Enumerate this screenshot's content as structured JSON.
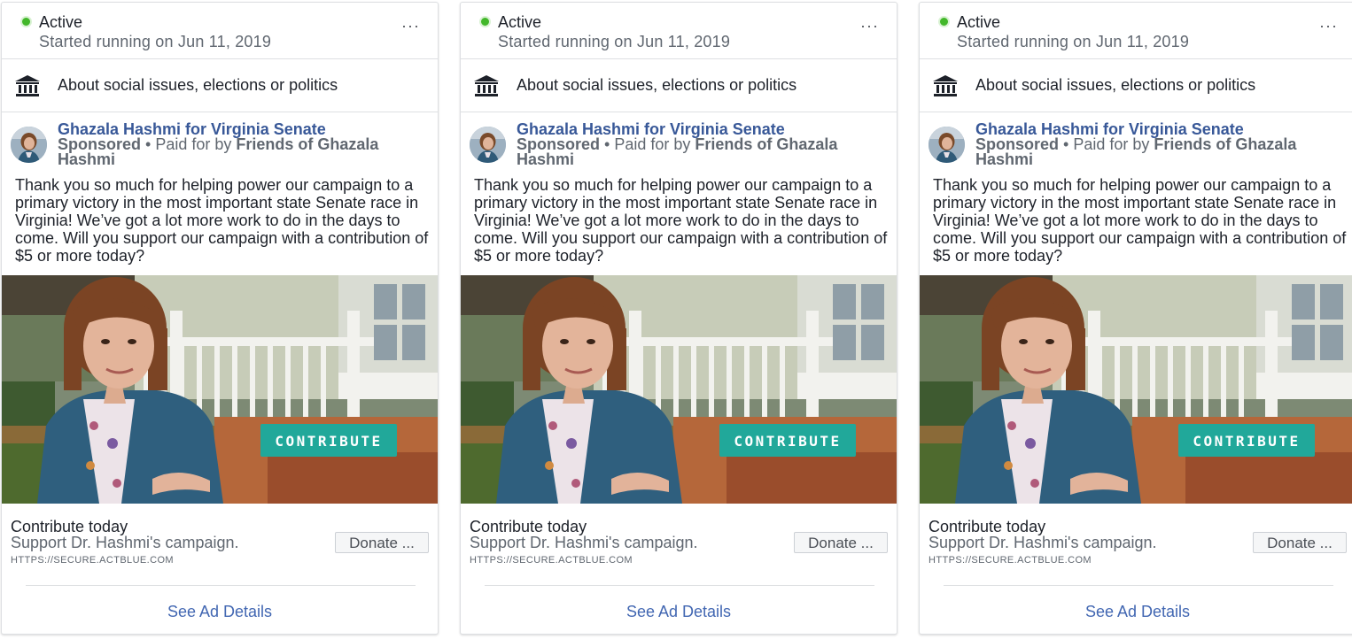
{
  "cards": [
    {
      "status": "Active",
      "started": "Started running on Jun 11, 2019",
      "more_label": "···",
      "category": "About social issues, elections or politics",
      "page_name": "Ghazala Hashmi for Virginia Senate",
      "sponsored": "Sponsored",
      "separator": " • ",
      "paid_for_prefix": "Paid for by ",
      "paid_for_by": "Friends of Ghazala Hashmi",
      "body": "Thank you so much for helping power our campaign to a primary victory in the most important state Senate race in Virginia! We’ve got a lot more work to do in the days to come. Will you support our campaign with a contribution of $5 or more today?",
      "image_button_text": "CONTRIBUTE",
      "cta_title": "Contribute today",
      "cta_description": "Support Dr. Hashmi's campaign.",
      "cta_url": "HTTPS://SECURE.ACTBLUE.COM",
      "cta_button": "Donate ...",
      "details_link": "See Ad Details"
    },
    {
      "status": "Active",
      "started": "Started running on Jun 11, 2019",
      "more_label": "···",
      "category": "About social issues, elections or politics",
      "page_name": "Ghazala Hashmi for Virginia Senate",
      "sponsored": "Sponsored",
      "separator": " • ",
      "paid_for_prefix": "Paid for by ",
      "paid_for_by": "Friends of Ghazala Hashmi",
      "body": "Thank you so much for helping power our campaign to a primary victory in the most important state Senate race in Virginia! We’ve got a lot more work to do in the days to come. Will you support our campaign with a contribution of $5 or more today?",
      "image_button_text": "CONTRIBUTE",
      "cta_title": "Contribute today",
      "cta_description": "Support Dr. Hashmi's campaign.",
      "cta_url": "HTTPS://SECURE.ACTBLUE.COM",
      "cta_button": "Donate ...",
      "details_link": "See Ad Details"
    },
    {
      "status": "Active",
      "started": "Started running on Jun 11, 2019",
      "more_label": "···",
      "category": "About social issues, elections or politics",
      "page_name": "Ghazala Hashmi for Virginia Senate",
      "sponsored": "Sponsored",
      "separator": " • ",
      "paid_for_prefix": "Paid for by ",
      "paid_for_by": "Friends of Ghazala Hashmi",
      "body": "Thank you so much for helping power our campaign to a primary victory in the most important state Senate race in Virginia! We’ve got a lot more work to do in the days to come. Will you support our campaign with a contribution of $5 or more today?",
      "image_button_text": "CONTRIBUTE",
      "cta_title": "Contribute today",
      "cta_description": "Support Dr. Hashmi's campaign.",
      "cta_url": "HTTPS://SECURE.ACTBLUE.COM",
      "cta_button": "Donate ...",
      "details_link": "See Ad Details"
    }
  ],
  "icons": {
    "status": "active-dot-icon",
    "more": "more-options-icon",
    "category": "bank-building-icon",
    "avatar": "page-avatar"
  },
  "colors": {
    "active": "#42b72a",
    "link": "#385898",
    "details_link": "#4267b2",
    "image_button": "#21a89a"
  }
}
